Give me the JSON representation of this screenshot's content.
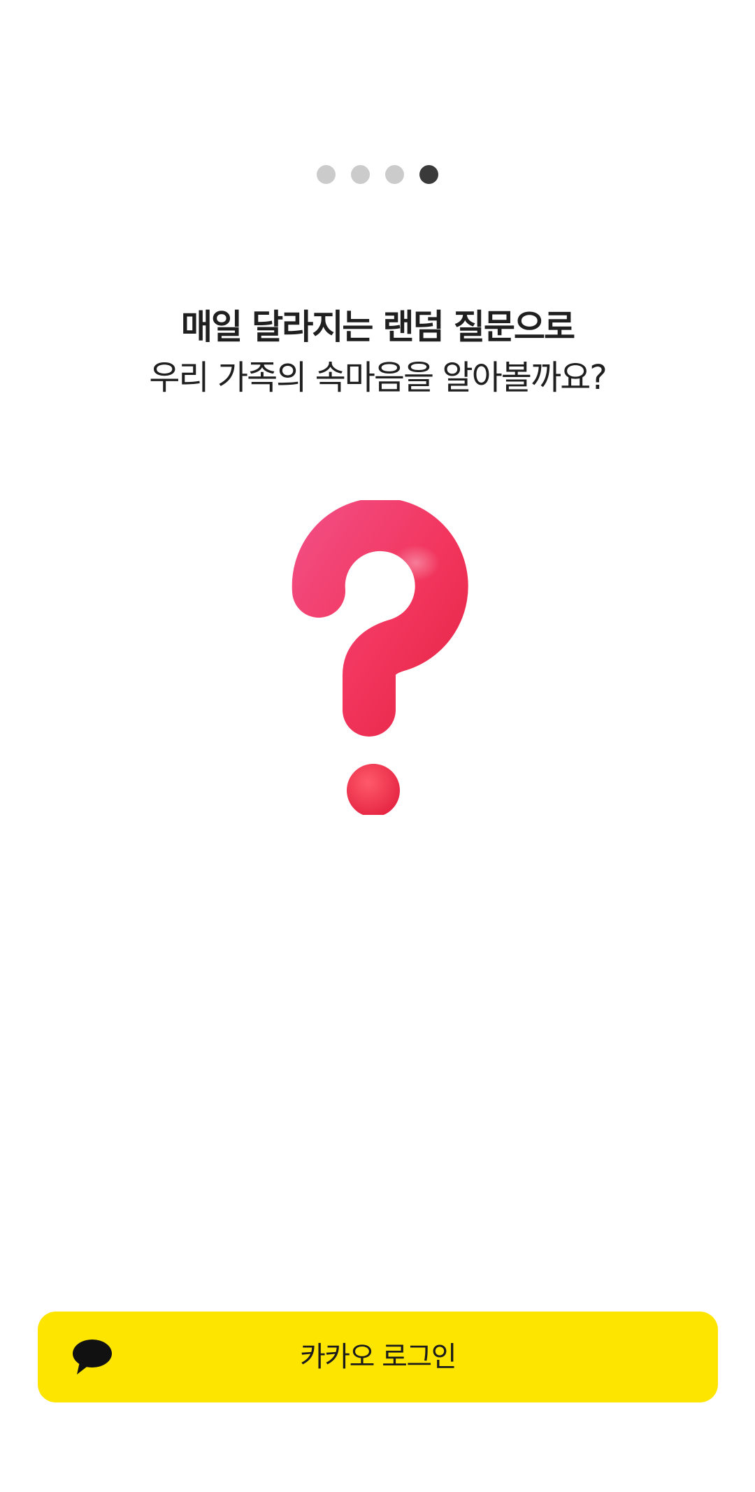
{
  "pager": {
    "total": 4,
    "active_index": 3
  },
  "headline": {
    "line1": "매일 달라지는 랜덤 질문으로",
    "line2": "우리 가족의 속마음을 알아볼까요?"
  },
  "illustration": {
    "icon": "question-mark-icon",
    "color": "#f2365e"
  },
  "login": {
    "label": "카카오 로그인",
    "icon": "kakao-chat-bubble-icon",
    "background": "#fee500"
  }
}
